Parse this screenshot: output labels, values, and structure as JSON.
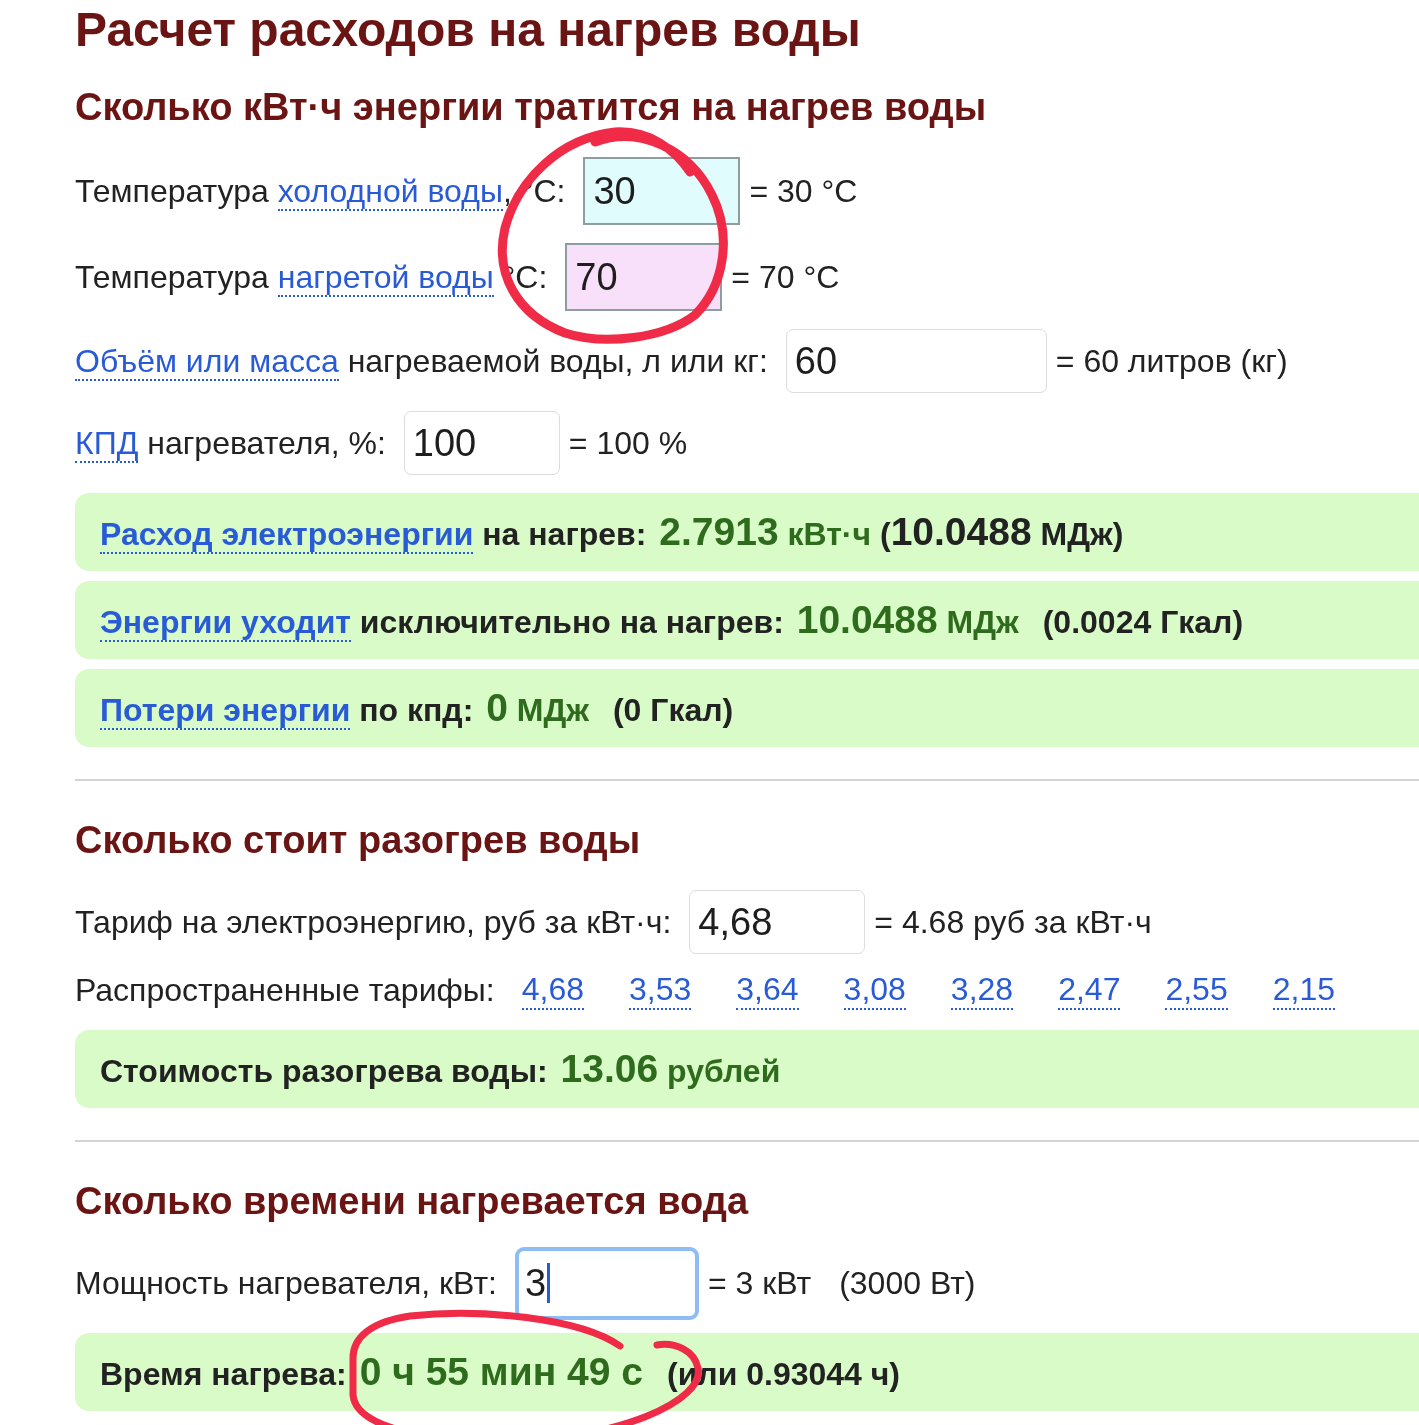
{
  "title": "Расчет расходов на нагрев воды",
  "sections": [
    {
      "heading": "Сколько кВт·ч энергии тратится на нагрев воды",
      "fields": [
        {
          "label": [
            {
              "kind": "text",
              "text": "Температура "
            },
            {
              "kind": "link",
              "text": "холодной воды"
            },
            {
              "kind": "text",
              "text": ", °C:"
            }
          ],
          "value": "30",
          "color": "#e0fcfc",
          "focused": false,
          "result": [
            "= 30 °C"
          ]
        },
        {
          "label": [
            {
              "kind": "text",
              "text": "Температура "
            },
            {
              "kind": "link",
              "text": "нагретой воды"
            },
            {
              "kind": "text",
              "text": " °C:"
            }
          ],
          "value": "70",
          "color": "#f8e0fa",
          "focused": false,
          "result": [
            "= 70 °C"
          ]
        },
        {
          "label": [
            {
              "kind": "link",
              "text": "Объём или масса"
            },
            {
              "kind": "text",
              "text": " нагреваемой воды, л или кг:"
            }
          ],
          "value": "60",
          "focused": false,
          "result": [
            "= 60 литров (кг)"
          ]
        },
        {
          "label": [
            {
              "kind": "link",
              "text": "КПД"
            },
            {
              "kind": "text",
              "text": " нагревателя, %:"
            }
          ],
          "value": "100",
          "focused": false,
          "result": [
            "= 100 %"
          ]
        }
      ],
      "results": [
        [
          {
            "kind": "link",
            "text": "Расход электроэнергии"
          },
          {
            "kind": "text",
            "text": " на нагрев: "
          },
          {
            "kind": "value",
            "text": "2.7913"
          },
          {
            "kind": "unit",
            "text": " кВт·ч"
          },
          {
            "kind": "text",
            "text": " ("
          },
          {
            "kind": "big",
            "text": "10.0488"
          },
          {
            "kind": "text",
            "text": " МДж)"
          }
        ],
        [
          {
            "kind": "link",
            "text": "Энергии уходит"
          },
          {
            "kind": "text",
            "text": " исключительно на нагрев: "
          },
          {
            "kind": "value",
            "text": "10.0488"
          },
          {
            "kind": "unit",
            "text": " МДж"
          },
          {
            "kind": "aside",
            "text": "(0.0024 Гкал)"
          }
        ],
        [
          {
            "kind": "link",
            "text": "Потери энергии"
          },
          {
            "kind": "text",
            "text": " по кпд: "
          },
          {
            "kind": "value",
            "text": "0"
          },
          {
            "kind": "unit",
            "text": " МДж"
          },
          {
            "kind": "aside",
            "text": "(0 Гкал)"
          }
        ]
      ]
    },
    {
      "heading": "Сколько стоит разогрев воды",
      "fields": [
        {
          "label": [
            {
              "kind": "text",
              "text": "Тариф на электроэнергию, руб за кВт·ч:"
            }
          ],
          "value": "4,68",
          "focused": false,
          "result": [
            "= 4.68 руб за кВт·ч"
          ]
        }
      ],
      "presets": {
        "label": "Распространенные тарифы:",
        "links": [
          "4,68",
          "3,53",
          "3,64",
          "3,08",
          "3,28",
          "2,47",
          "2,55",
          "2,15"
        ]
      },
      "results": [
        [
          {
            "kind": "text",
            "text": "Стоимость разогрева воды: "
          },
          {
            "kind": "value",
            "text": "13.06"
          },
          {
            "kind": "unit",
            "text": " рублей"
          }
        ]
      ]
    },
    {
      "heading": "Сколько времени нагревается вода",
      "fields": [
        {
          "label": [
            {
              "kind": "text",
              "text": "Мощность нагревателя, кВт:"
            }
          ],
          "value": "3",
          "focused": true,
          "result": [
            "= 3 кВт",
            "(3000 Вт)"
          ]
        }
      ],
      "results": [
        [
          {
            "kind": "text",
            "text": "Время нагрева: "
          },
          {
            "kind": "value",
            "text": "0 ч 55 мин 49 с"
          },
          {
            "kind": "aside",
            "text": "(или 0.93044 ч)"
          }
        ]
      ]
    }
  ]
}
